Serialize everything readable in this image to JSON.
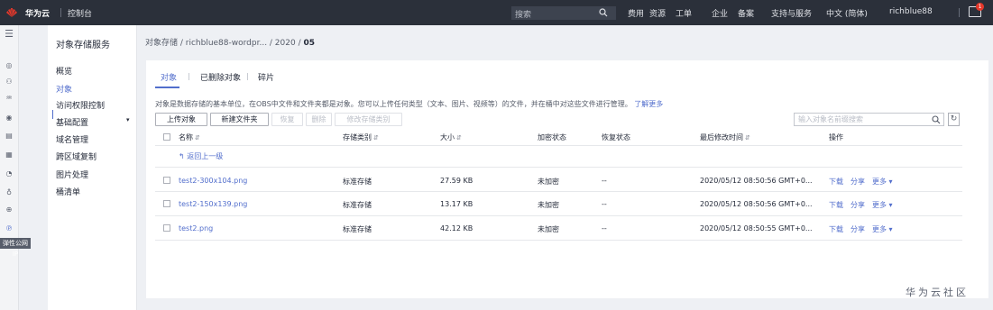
{
  "topbar": {
    "brand": "华为云",
    "console": "控制台",
    "search_placeholder": "搜索",
    "nav": [
      "费用",
      "资源",
      "工单",
      "企业",
      "备案",
      "支持与服务",
      "中文 (简体)",
      "richblue88"
    ],
    "notification_count": "1"
  },
  "rail": {
    "eip_label": "弹性公网IP"
  },
  "side": {
    "title": "对象存储服务",
    "items": [
      "概览",
      "对象",
      "访问权限控制",
      "基础配置",
      "域名管理",
      "跨区域复制",
      "图片处理",
      "桶清单"
    ]
  },
  "breadcrumb": {
    "path": "对象存储 / richblue88-wordpr... / 2020 / ",
    "current": "05"
  },
  "tabs": [
    "对象",
    "已删除对象",
    "碎片"
  ],
  "description": "对象是数据存储的基本单位，在OBS中文件和文件夹都是对象。您可以上传任何类型（文本、图片、视频等）的文件，并在桶中对这些文件进行管理。",
  "learn_more": "了解更多",
  "toolbar": {
    "upload": "上传对象",
    "new_folder": "新建文件夹",
    "restore": "恢复",
    "delete": "删除",
    "change_storage": "修改存储类别",
    "search_placeholder": "输入对象名前缀搜索"
  },
  "table": {
    "headers": [
      "名称",
      "存储类别",
      "大小",
      "加密状态",
      "恢复状态",
      "最后修改时间",
      "操作"
    ],
    "back_label": "返回上一级",
    "rows": [
      {
        "name": "test2-300x104.png",
        "storage": "标准存储",
        "size": "27.59 KB",
        "encryption": "未加密",
        "restore": "--",
        "modified": "2020/05/12 08:50:56 GMT+0..."
      },
      {
        "name": "test2-150x139.png",
        "storage": "标准存储",
        "size": "13.17 KB",
        "encryption": "未加密",
        "restore": "--",
        "modified": "2020/05/12 08:50:56 GMT+0..."
      },
      {
        "name": "test2.png",
        "storage": "标准存储",
        "size": "42.12 KB",
        "encryption": "未加密",
        "restore": "--",
        "modified": "2020/05/12 08:50:55 GMT+0..."
      }
    ],
    "ops": [
      "下载",
      "分享",
      "更多"
    ]
  },
  "footer": {
    "watermark": "华为云社区"
  },
  "colors": {
    "accent": "#526ecc",
    "topbar": "#2b303a",
    "badge": "#e5382b"
  }
}
